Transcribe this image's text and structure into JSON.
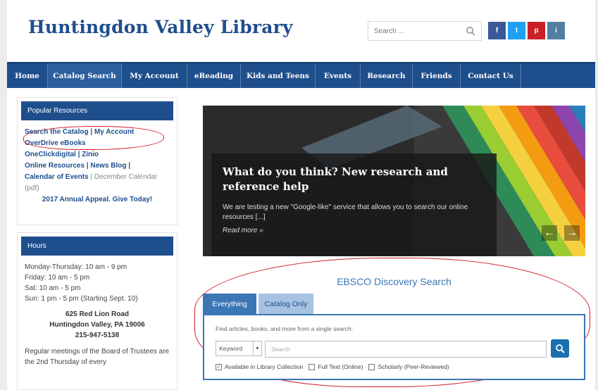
{
  "header": {
    "title": "Huntingdon Valley Library",
    "search_placeholder": "Search ...",
    "social": [
      "f",
      "t",
      "p",
      "i"
    ]
  },
  "nav": {
    "items": [
      "Home",
      "Catalog Search",
      "My Account",
      "eReading",
      "Kids and Teens",
      "Events",
      "Research",
      "Friends",
      "Contact Us"
    ],
    "active": "Catalog Search"
  },
  "popular": {
    "heading": "Popular Resources",
    "catalog": "Search the Catalog",
    "sep1": " | ",
    "account": "My Account",
    "overdrive": "OverDrive eBooks",
    "oneclick": "OneClickdigital",
    "sep2": " | ",
    "zinio": "Zinio",
    "online": "Online Resources",
    "sep3": " | ",
    "news": "News Blog",
    "sep4": " | ",
    "calendar": "Calendar of Events",
    "sep5": " | ",
    "december": "December Calendar (pdf)",
    "appeal": "2017 Annual Appeal. Give Today!"
  },
  "hours": {
    "heading": "Hours",
    "lines": [
      "Monday-Thursday: 10 am - 9 pm",
      "Friday: 10 am - 5 pm",
      "Sat: 10 am - 5 pm",
      "Sun: 1 pm - 5 pm (Starting Sept. 10)"
    ],
    "address": [
      "625 Red Lion Road",
      "Huntingdon Valley, PA 19006",
      "215-947-5138"
    ],
    "board": "Regular meetings of the Board of Trustees are the 2nd Thursday of every"
  },
  "slider": {
    "title": "What do you think? New research and reference help",
    "text": "We are testing a new \"Google-like\" service that allows you to search our online resources [...]",
    "more": "Read more »",
    "prev": "←",
    "next": "→"
  },
  "ebsco": {
    "title": "EBSCO Discovery Search",
    "tab_everything": "Everything",
    "tab_catalog": "Catalog Only",
    "find_text": "Find articles, books, and more from a single search:",
    "select_value": "Keyword",
    "input_placeholder": "Search",
    "check1": "Available in Library Collection",
    "check2": "Full Text (Online)",
    "check3": "Scholarly (Peer-Reviewed)"
  },
  "colors": {
    "brand": "#1e4e8c",
    "accent": "#3b76b5",
    "annotation": "#d21d2a"
  }
}
